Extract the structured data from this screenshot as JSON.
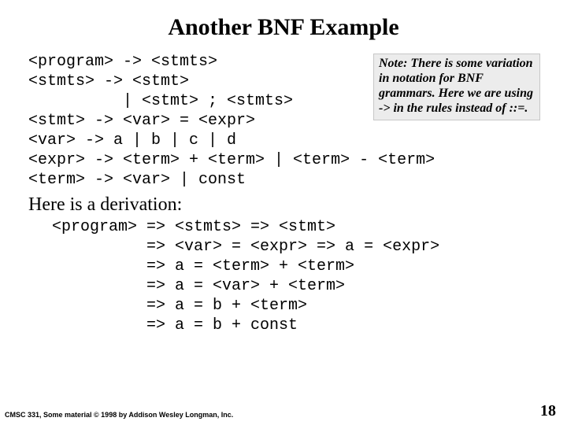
{
  "title": "Another BNF  Example",
  "grammar_lines": [
    "<program> -> <stmts>",
    "<stmts> -> <stmt>",
    "          | <stmt> ; <stmts>",
    "<stmt> -> <var> = <expr>",
    "<var> -> a | b | c | d",
    "<expr> -> <term> + <term> | <term> - <term>",
    "<term> -> <var> | const"
  ],
  "note": "Note: There is some variation in notation for BNF grammars. Here we are using -> in the rules instead of ::=.",
  "section_label": "Here is a  derivation:",
  "derivation_lines": [
    "<program> => <stmts> => <stmt>",
    "          => <var> = <expr> => a = <expr>",
    "          => a = <term> + <term>",
    "          => a = <var> + <term>",
    "          => a = b + <term>",
    "          => a = b + const"
  ],
  "footer_left": "CMSC 331, Some material © 1998 by Addison Wesley Longman, Inc.",
  "page_number": "18"
}
